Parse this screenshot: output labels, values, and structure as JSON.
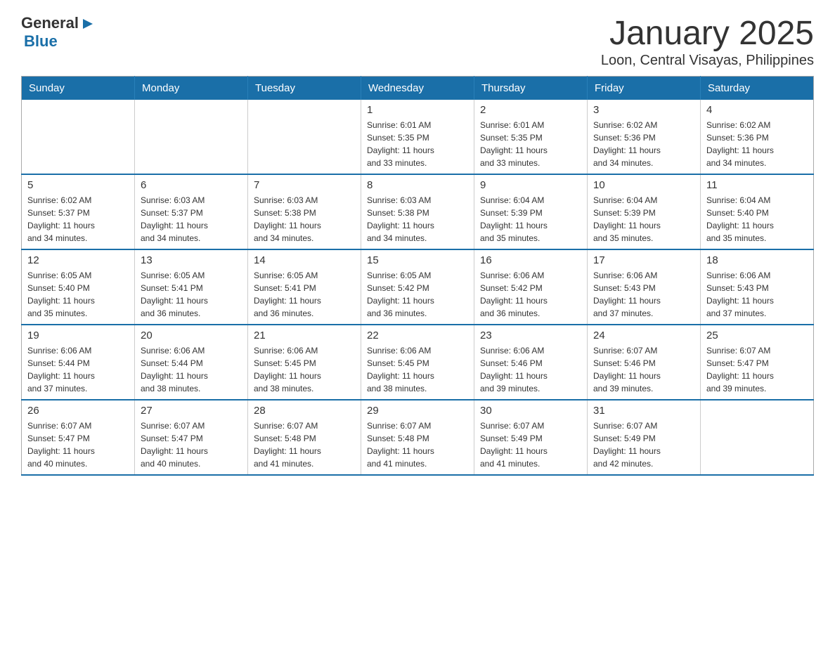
{
  "header": {
    "logo_general": "General",
    "logo_blue": "Blue",
    "month_title": "January 2025",
    "location": "Loon, Central Visayas, Philippines"
  },
  "calendar": {
    "days_of_week": [
      "Sunday",
      "Monday",
      "Tuesday",
      "Wednesday",
      "Thursday",
      "Friday",
      "Saturday"
    ],
    "weeks": [
      [
        {
          "day": "",
          "info": ""
        },
        {
          "day": "",
          "info": ""
        },
        {
          "day": "",
          "info": ""
        },
        {
          "day": "1",
          "info": "Sunrise: 6:01 AM\nSunset: 5:35 PM\nDaylight: 11 hours\nand 33 minutes."
        },
        {
          "day": "2",
          "info": "Sunrise: 6:01 AM\nSunset: 5:35 PM\nDaylight: 11 hours\nand 33 minutes."
        },
        {
          "day": "3",
          "info": "Sunrise: 6:02 AM\nSunset: 5:36 PM\nDaylight: 11 hours\nand 34 minutes."
        },
        {
          "day": "4",
          "info": "Sunrise: 6:02 AM\nSunset: 5:36 PM\nDaylight: 11 hours\nand 34 minutes."
        }
      ],
      [
        {
          "day": "5",
          "info": "Sunrise: 6:02 AM\nSunset: 5:37 PM\nDaylight: 11 hours\nand 34 minutes."
        },
        {
          "day": "6",
          "info": "Sunrise: 6:03 AM\nSunset: 5:37 PM\nDaylight: 11 hours\nand 34 minutes."
        },
        {
          "day": "7",
          "info": "Sunrise: 6:03 AM\nSunset: 5:38 PM\nDaylight: 11 hours\nand 34 minutes."
        },
        {
          "day": "8",
          "info": "Sunrise: 6:03 AM\nSunset: 5:38 PM\nDaylight: 11 hours\nand 34 minutes."
        },
        {
          "day": "9",
          "info": "Sunrise: 6:04 AM\nSunset: 5:39 PM\nDaylight: 11 hours\nand 35 minutes."
        },
        {
          "day": "10",
          "info": "Sunrise: 6:04 AM\nSunset: 5:39 PM\nDaylight: 11 hours\nand 35 minutes."
        },
        {
          "day": "11",
          "info": "Sunrise: 6:04 AM\nSunset: 5:40 PM\nDaylight: 11 hours\nand 35 minutes."
        }
      ],
      [
        {
          "day": "12",
          "info": "Sunrise: 6:05 AM\nSunset: 5:40 PM\nDaylight: 11 hours\nand 35 minutes."
        },
        {
          "day": "13",
          "info": "Sunrise: 6:05 AM\nSunset: 5:41 PM\nDaylight: 11 hours\nand 36 minutes."
        },
        {
          "day": "14",
          "info": "Sunrise: 6:05 AM\nSunset: 5:41 PM\nDaylight: 11 hours\nand 36 minutes."
        },
        {
          "day": "15",
          "info": "Sunrise: 6:05 AM\nSunset: 5:42 PM\nDaylight: 11 hours\nand 36 minutes."
        },
        {
          "day": "16",
          "info": "Sunrise: 6:06 AM\nSunset: 5:42 PM\nDaylight: 11 hours\nand 36 minutes."
        },
        {
          "day": "17",
          "info": "Sunrise: 6:06 AM\nSunset: 5:43 PM\nDaylight: 11 hours\nand 37 minutes."
        },
        {
          "day": "18",
          "info": "Sunrise: 6:06 AM\nSunset: 5:43 PM\nDaylight: 11 hours\nand 37 minutes."
        }
      ],
      [
        {
          "day": "19",
          "info": "Sunrise: 6:06 AM\nSunset: 5:44 PM\nDaylight: 11 hours\nand 37 minutes."
        },
        {
          "day": "20",
          "info": "Sunrise: 6:06 AM\nSunset: 5:44 PM\nDaylight: 11 hours\nand 38 minutes."
        },
        {
          "day": "21",
          "info": "Sunrise: 6:06 AM\nSunset: 5:45 PM\nDaylight: 11 hours\nand 38 minutes."
        },
        {
          "day": "22",
          "info": "Sunrise: 6:06 AM\nSunset: 5:45 PM\nDaylight: 11 hours\nand 38 minutes."
        },
        {
          "day": "23",
          "info": "Sunrise: 6:06 AM\nSunset: 5:46 PM\nDaylight: 11 hours\nand 39 minutes."
        },
        {
          "day": "24",
          "info": "Sunrise: 6:07 AM\nSunset: 5:46 PM\nDaylight: 11 hours\nand 39 minutes."
        },
        {
          "day": "25",
          "info": "Sunrise: 6:07 AM\nSunset: 5:47 PM\nDaylight: 11 hours\nand 39 minutes."
        }
      ],
      [
        {
          "day": "26",
          "info": "Sunrise: 6:07 AM\nSunset: 5:47 PM\nDaylight: 11 hours\nand 40 minutes."
        },
        {
          "day": "27",
          "info": "Sunrise: 6:07 AM\nSunset: 5:47 PM\nDaylight: 11 hours\nand 40 minutes."
        },
        {
          "day": "28",
          "info": "Sunrise: 6:07 AM\nSunset: 5:48 PM\nDaylight: 11 hours\nand 41 minutes."
        },
        {
          "day": "29",
          "info": "Sunrise: 6:07 AM\nSunset: 5:48 PM\nDaylight: 11 hours\nand 41 minutes."
        },
        {
          "day": "30",
          "info": "Sunrise: 6:07 AM\nSunset: 5:49 PM\nDaylight: 11 hours\nand 41 minutes."
        },
        {
          "day": "31",
          "info": "Sunrise: 6:07 AM\nSunset: 5:49 PM\nDaylight: 11 hours\nand 42 minutes."
        },
        {
          "day": "",
          "info": ""
        }
      ]
    ]
  }
}
